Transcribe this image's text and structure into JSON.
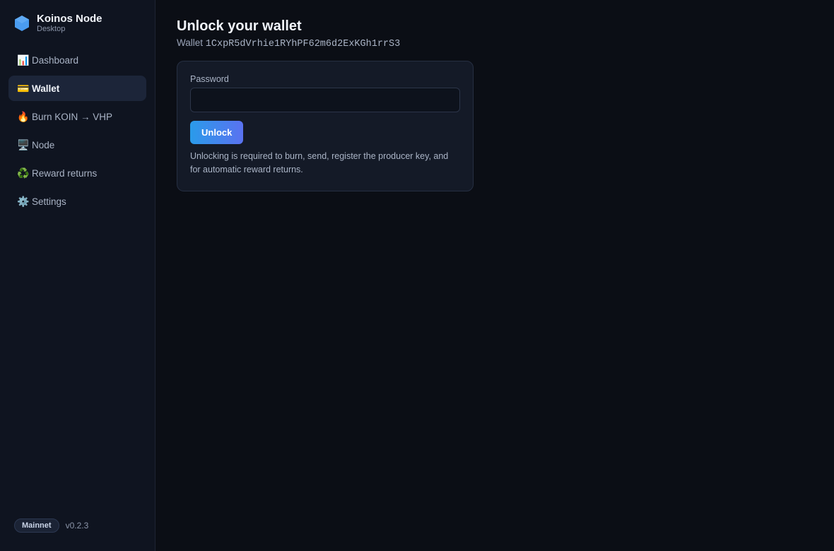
{
  "brand": {
    "title": "Koinos Node",
    "subtitle": "Desktop",
    "logo_icon": "hexagon-icon",
    "logo_color": "#4a9cf0"
  },
  "sidebar": {
    "items": [
      {
        "icon": "📊",
        "icon_name": "bar-chart-icon",
        "label": "Dashboard",
        "active": false
      },
      {
        "icon": "💳",
        "icon_name": "credit-card-icon",
        "label": "Wallet",
        "active": true
      },
      {
        "icon": "🔥",
        "icon_name": "fire-icon",
        "label": "Burn KOIN → VHP",
        "active": false
      },
      {
        "icon": "🖥️",
        "icon_name": "desktop-computer-icon",
        "label": "Node",
        "active": false
      },
      {
        "icon": "♻️",
        "icon_name": "recycle-icon",
        "label": "Reward returns",
        "active": false
      },
      {
        "icon": "⚙️",
        "icon_name": "gear-icon",
        "label": "Settings",
        "active": false
      }
    ],
    "network_badge": "Mainnet",
    "version": "v0.2.3"
  },
  "main": {
    "title": "Unlock your wallet",
    "wallet_prefix": "Wallet",
    "wallet_address": "1CxpR5dVrhie1RYhPF62m6d2ExKGh1rrS3",
    "password_label": "Password",
    "password_value": "",
    "unlock_label": "Unlock",
    "hint": "Unlocking is required to burn, send, register the producer key, and for automatic reward returns."
  },
  "colors": {
    "accent_start": "#2a9bea",
    "accent_end": "#5a72f0",
    "background": "#0b0e15",
    "sidebar_bg": "#0f1420",
    "active_item_bg": "#1c2539"
  }
}
